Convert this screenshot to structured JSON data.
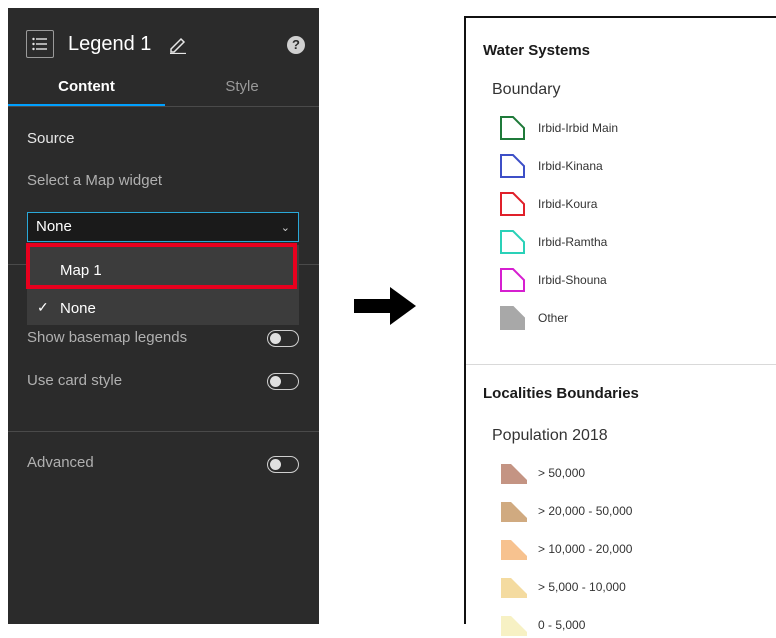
{
  "panel": {
    "title": "Legend 1",
    "help_glyph": "?",
    "tabs": [
      {
        "label": "Content",
        "active": true
      },
      {
        "label": "Style",
        "active": false
      }
    ],
    "source_label": "Source",
    "select_map_label": "Select a Map widget",
    "select_value": "None",
    "dropdown_options": [
      {
        "label": "Map 1",
        "highlighted": true
      },
      {
        "label": "None",
        "checked": true
      }
    ],
    "check_glyph": "✓",
    "chevron_glyph": "⌄",
    "show_basemap_label": "Show basemap legends",
    "card_style_label": "Use card style",
    "advanced_label": "Advanced",
    "toggles": {
      "show_basemap": false,
      "card_style": false,
      "advanced": false
    },
    "accent": "#00a0ff",
    "highlight_color": "#e8001e"
  },
  "legend": {
    "section1": {
      "title": "Water Systems",
      "subtitle": "Boundary",
      "items": [
        {
          "label": "Irbid-Irbid Main",
          "stroke": "#1f7a3a",
          "fill": "none"
        },
        {
          "label": "Irbid-Kinana",
          "stroke": "#3d4fc7",
          "fill": "none"
        },
        {
          "label": "Irbid-Koura",
          "stroke": "#e0202a",
          "fill": "none"
        },
        {
          "label": "Irbid-Ramtha",
          "stroke": "#2ad1b8",
          "fill": "none"
        },
        {
          "label": "Irbid-Shouna",
          "stroke": "#d61fd0",
          "fill": "none"
        },
        {
          "label": "Other",
          "stroke": "#a8a8a8",
          "fill": "#a8a8a8"
        }
      ]
    },
    "section2": {
      "title": "Localities Boundaries",
      "subtitle": "Population 2018",
      "items": [
        {
          "label": "> 50,000",
          "fill": "#c49483"
        },
        {
          "label": "> 20,000 - 50,000",
          "fill": "#d0aa80"
        },
        {
          "label": "> 10,000 - 20,000",
          "fill": "#f7c28f"
        },
        {
          "label": "> 5,000 - 10,000",
          "fill": "#f4dba0"
        },
        {
          "label": "0 - 5,000",
          "fill": "#f7f1c4"
        }
      ]
    }
  },
  "arrow_icon": "right-arrow-icon"
}
